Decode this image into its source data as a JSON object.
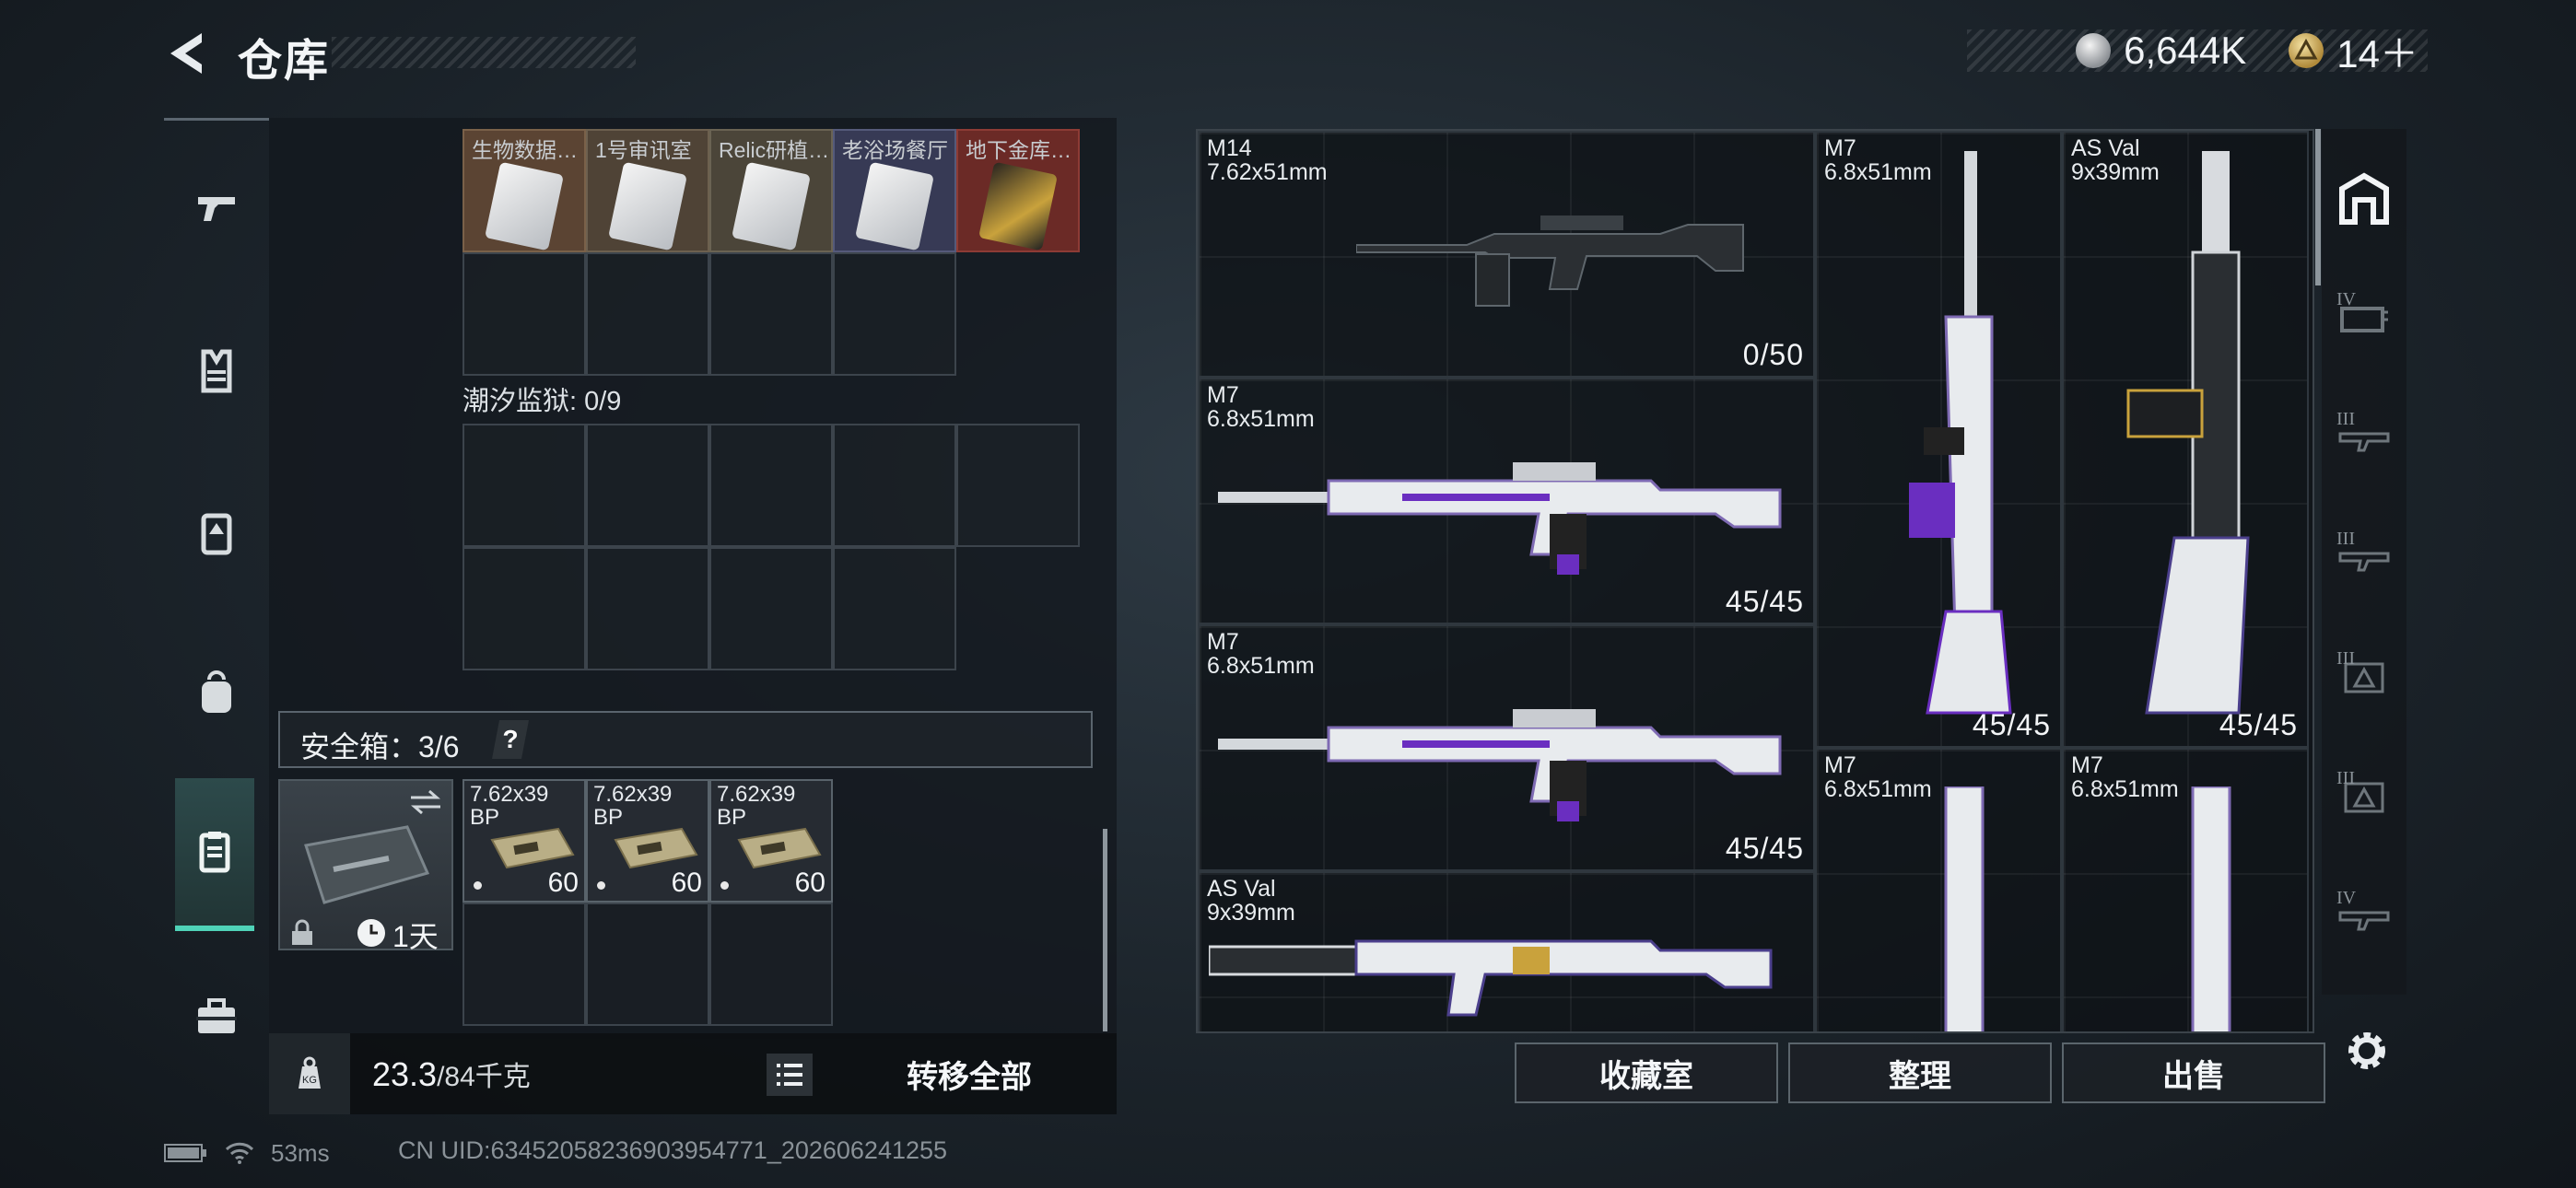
{
  "header": {
    "title": "仓库",
    "currency": [
      {
        "icon": "silver-coin-icon",
        "value": "6,644K"
      },
      {
        "icon": "gold-triangle-coin-icon",
        "value": "14＋"
      }
    ]
  },
  "left_tabs": [
    {
      "icon": "pistol-icon",
      "active": false
    },
    {
      "icon": "armor-vest-icon",
      "active": false
    },
    {
      "icon": "rig-icon",
      "active": false
    },
    {
      "icon": "backpack-icon",
      "active": false
    },
    {
      "icon": "clipboard-icon",
      "active": true
    },
    {
      "icon": "toolbox-icon",
      "active": false
    }
  ],
  "stash": {
    "key_cards": [
      {
        "label": "生物数据…",
        "color": "#5b4433"
      },
      {
        "label": "1号审讯室",
        "color": "#4f4336"
      },
      {
        "label": "Relic研植…",
        "color": "#4b4539"
      },
      {
        "label": "老浴场餐厅",
        "color": "#373a55"
      },
      {
        "label": "地下金库…",
        "color": "#6b2a26"
      }
    ],
    "prison_label": "潮汐监狱: 0/9",
    "safe_label": "安全箱：3/6",
    "help": "?",
    "safe_box": {
      "timer": "1天"
    },
    "ammo": [
      {
        "name": "7.62x39\nBP",
        "count": "60"
      },
      {
        "name": "7.62x39\nBP",
        "count": "60"
      },
      {
        "name": "7.62x39\nBP",
        "count": "60"
      }
    ]
  },
  "bottom_bar": {
    "weight_value": "23.3",
    "weight_cap": "/84千克",
    "transfer_all": "转移全部"
  },
  "weapons": [
    {
      "name": "M14",
      "caliber": "7.62x51mm",
      "ammo": "0/50"
    },
    {
      "name": "M7",
      "caliber": "6.8x51mm",
      "ammo": "45/45"
    },
    {
      "name": "AS Val",
      "caliber": "9x39mm",
      "ammo": "45/45"
    },
    {
      "name": "M7",
      "caliber": "6.8x51mm",
      "ammo": "45/45"
    },
    {
      "name": "M7",
      "caliber": "6.8x51mm",
      "ammo": "45/45"
    },
    {
      "name": "M7",
      "caliber": "6.8x51mm",
      "ammo": ""
    },
    {
      "name": "M7",
      "caliber": "6.8x51mm",
      "ammo": ""
    },
    {
      "name": "AS Val",
      "caliber": "9x39mm",
      "ammo": ""
    }
  ],
  "side_rail": {
    "tiers": [
      "",
      "IV",
      "III",
      "III",
      "III",
      "III",
      "IV"
    ]
  },
  "actions": {
    "collection": "收藏室",
    "sort": "整理",
    "sell": "出售"
  },
  "footer": {
    "ping": "53ms",
    "uid": "CN UID:634520582369039547​71_202606241255"
  }
}
